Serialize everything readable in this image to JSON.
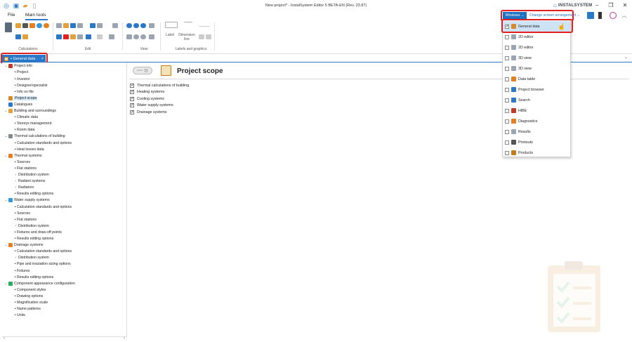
{
  "window": {
    "title": "New project* - InstalSystem Editor 5 BETA-EN (Rev. 23.87)",
    "brand": "INSTALSYSTEM"
  },
  "menu": {
    "file": "File",
    "main_tools": "Main tools"
  },
  "ribbon": {
    "groups": [
      "Calculations",
      "Edit",
      "View",
      "Labels and graphics"
    ],
    "label_btn": "Label",
    "dimension_btn": "Dimension line"
  },
  "windows_toolbar": {
    "windows_label": "Windows",
    "change_label": "Change screen arrangement"
  },
  "doc_tab": {
    "label": "• General data",
    "close": "×"
  },
  "tree": [
    {
      "level": 0,
      "expander": "⌄",
      "label": "Project info",
      "icon": "#c0392b"
    },
    {
      "level": 1,
      "bullet": true,
      "label": "Project"
    },
    {
      "level": 1,
      "bullet": true,
      "label": "Investor"
    },
    {
      "level": 1,
      "bullet": true,
      "label": "Designer/specialist"
    },
    {
      "level": 1,
      "bullet": true,
      "label": "Info on file"
    },
    {
      "level": 0,
      "expander": "",
      "label": "Project scope",
      "icon": "#d48a2a",
      "selected": true
    },
    {
      "level": 0,
      "expander": "",
      "label": "Catalogues",
      "icon": "#2b78c8"
    },
    {
      "level": 0,
      "expander": "⌄",
      "label": "Building and surroundings",
      "icon": "#e2a23b"
    },
    {
      "level": 1,
      "bullet": true,
      "label": "Climatic data"
    },
    {
      "level": 1,
      "bullet": true,
      "label": "Storeys management"
    },
    {
      "level": 1,
      "bullet": true,
      "label": "Room data"
    },
    {
      "level": 0,
      "expander": "⌄",
      "label": "Thermal calculations of building",
      "icon": "#7f8c8d"
    },
    {
      "level": 1,
      "bullet": true,
      "label": "Calculation standards and options"
    },
    {
      "level": 1,
      "bullet": true,
      "label": "Heat losses data"
    },
    {
      "level": 0,
      "expander": "⌄",
      "label": "Thermal systems",
      "icon": "#e67e22"
    },
    {
      "level": 1,
      "bullet": true,
      "label": "Sources"
    },
    {
      "level": 1,
      "bullet": true,
      "label": "Flat stations"
    },
    {
      "level": 1,
      "expander": "›",
      "label": "Distribution system"
    },
    {
      "level": 1,
      "expander": "›",
      "label": "Radiant systems"
    },
    {
      "level": 1,
      "expander": "›",
      "label": "Radiators"
    },
    {
      "level": 1,
      "bullet": true,
      "label": "Results editing options"
    },
    {
      "level": 0,
      "expander": "⌄",
      "label": "Water supply systems",
      "icon": "#3498db"
    },
    {
      "level": 1,
      "bullet": true,
      "label": "Calculation standards and options"
    },
    {
      "level": 1,
      "bullet": true,
      "label": "Sources"
    },
    {
      "level": 1,
      "bullet": true,
      "label": "Flat stations"
    },
    {
      "level": 1,
      "expander": "›",
      "label": "Distribution system"
    },
    {
      "level": 1,
      "bullet": true,
      "label": "Fixtures and draw-off points"
    },
    {
      "level": 1,
      "bullet": true,
      "label": "Results editing options"
    },
    {
      "level": 0,
      "expander": "⌄",
      "label": "Drainage systems",
      "icon": "#e67e22"
    },
    {
      "level": 1,
      "bullet": true,
      "label": "Calculation standards and options"
    },
    {
      "level": 1,
      "expander": "›",
      "label": "Distribution system"
    },
    {
      "level": 1,
      "bullet": true,
      "label": "Pipe and insulation sizing options"
    },
    {
      "level": 1,
      "bullet": true,
      "label": "Fixtures"
    },
    {
      "level": 1,
      "bullet": true,
      "label": "Results editing options"
    },
    {
      "level": 0,
      "expander": "⌄",
      "label": "Component appearance configuration",
      "icon": "#27ae60"
    },
    {
      "level": 1,
      "bullet": true,
      "label": "Component styles"
    },
    {
      "level": 1,
      "bullet": true,
      "label": "Drawing options"
    },
    {
      "level": 1,
      "bullet": true,
      "label": "Magnification scale"
    },
    {
      "level": 1,
      "bullet": true,
      "label": "Name patterns"
    },
    {
      "level": 1,
      "bullet": true,
      "label": "Units"
    }
  ],
  "page": {
    "title": "Project scope",
    "scope_items": [
      {
        "label": "Thermal calculations of building",
        "checked": true
      },
      {
        "label": "Heating systems",
        "checked": true
      },
      {
        "label": "Cooling systems",
        "checked": true
      },
      {
        "label": "Water supply systems",
        "checked": true
      },
      {
        "label": "Drainage systems",
        "checked": true
      }
    ]
  },
  "windows_menu": [
    {
      "label": "General data",
      "checked": true,
      "icon": "#d48a2a"
    },
    {
      "label": "2D editor",
      "checked": false,
      "icon": "#9aa5b1"
    },
    {
      "label": "2D editor",
      "checked": false,
      "icon": "#9aa5b1"
    },
    {
      "label": "3D view",
      "checked": false,
      "icon": "#9aa5b1"
    },
    {
      "label": "3D view",
      "checked": false,
      "icon": "#9aa5b1"
    },
    {
      "label": "Data table",
      "checked": false,
      "icon": "#e67e22"
    },
    {
      "label": "Project browser",
      "checked": false,
      "icon": "#2b78c8"
    },
    {
      "label": "Search",
      "checked": false,
      "icon": "#2b78c8"
    },
    {
      "label": "HiBE",
      "checked": false,
      "icon": "#c0392b"
    },
    {
      "label": "Diagnostics",
      "checked": false,
      "icon": "#e67e22"
    },
    {
      "label": "Results",
      "checked": false,
      "icon": "#9aa5b1"
    },
    {
      "label": "Printouts",
      "checked": false,
      "icon": "#555555"
    },
    {
      "label": "Products",
      "checked": false,
      "icon": "#c77a1a"
    }
  ],
  "colors": {
    "accent": "#2b78c8",
    "highlight": "#e02020"
  }
}
